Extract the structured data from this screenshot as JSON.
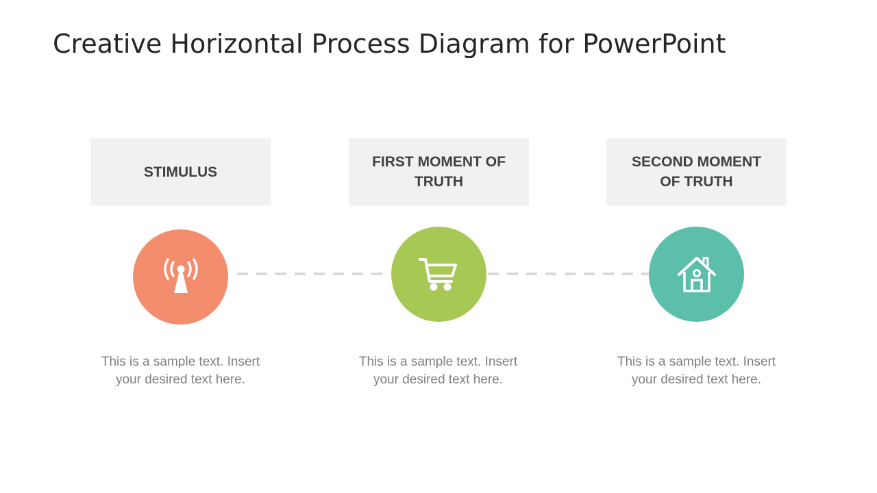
{
  "slide": {
    "title": "Creative Horizontal Process Diagram for PowerPoint"
  },
  "steps": [
    {
      "label": "STIMULUS",
      "icon": "antenna-signal-icon",
      "color": "#f48d6e",
      "description": "This is a sample  text. Insert your desired text here."
    },
    {
      "label": "FIRST MOMENT OF TRUTH",
      "icon": "shopping-cart-icon",
      "color": "#a8c855",
      "description": "This is a sample  text. Insert your desired text here."
    },
    {
      "label": "SECOND MOMENT OF TRUTH",
      "icon": "house-icon",
      "color": "#5bbfaa",
      "description": "This is a sample  text. Insert your desired text here."
    }
  ],
  "colors": {
    "label_bg": "#f1f1f1",
    "connector": "#d9d9d9"
  }
}
